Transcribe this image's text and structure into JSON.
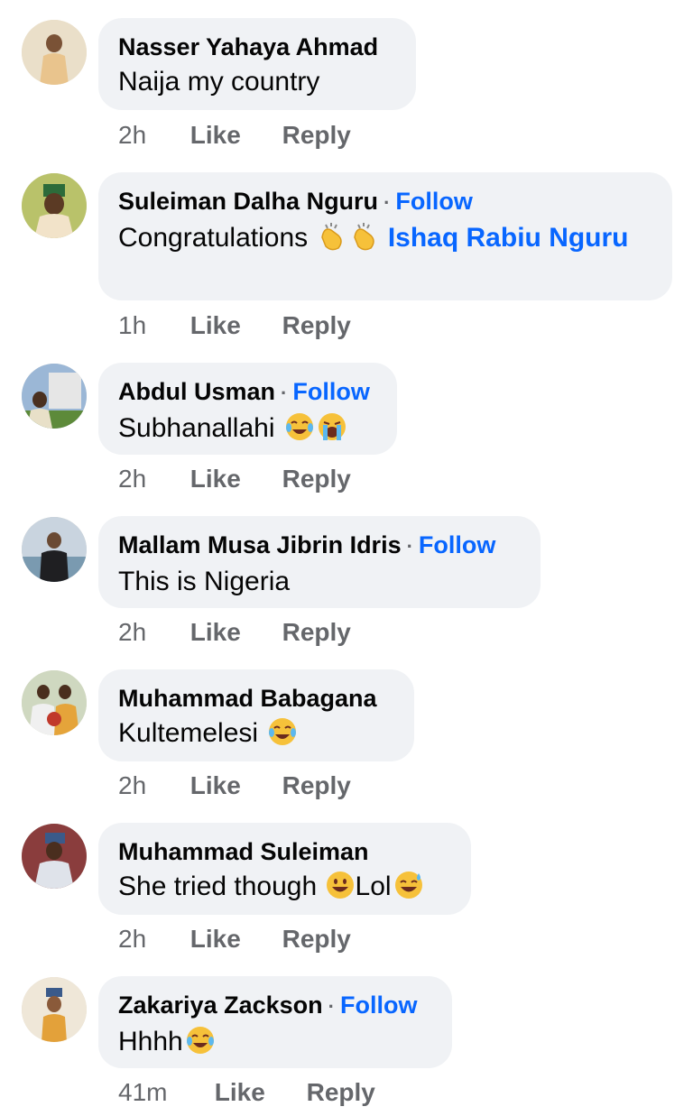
{
  "comments": [
    {
      "name": "Nasser Yahaya Ahmad",
      "follow": "",
      "text": "Naija my country",
      "time": "2h"
    },
    {
      "name": "Suleiman Dalha Nguru",
      "follow": "Follow",
      "text": "Congratulations",
      "mention": "Ishaq Rabiu Nguru",
      "time": "1h"
    },
    {
      "name": "Abdul Usman",
      "follow": "Follow",
      "text": "Subhanallahi",
      "time": "2h"
    },
    {
      "name": "Mallam Musa Jibrin Idris",
      "follow": "Follow",
      "text": "This is Nigeria",
      "time": "2h"
    },
    {
      "name": "Muhammad Babagana",
      "follow": "",
      "text": "Kultemelesi",
      "time": "2h"
    },
    {
      "name": "Muhammad Suleiman",
      "follow": "",
      "text": "She tried though",
      "text2": "Lol",
      "time": "2h"
    },
    {
      "name": "Zakariya Zackson",
      "follow": "Follow",
      "text": "Hhhh",
      "time": "41m"
    }
  ],
  "actions": {
    "like": "Like",
    "reply": "Reply"
  },
  "colors": {
    "bubble": "#f0f2f5",
    "link": "#0866ff",
    "meta": "#65676b"
  }
}
